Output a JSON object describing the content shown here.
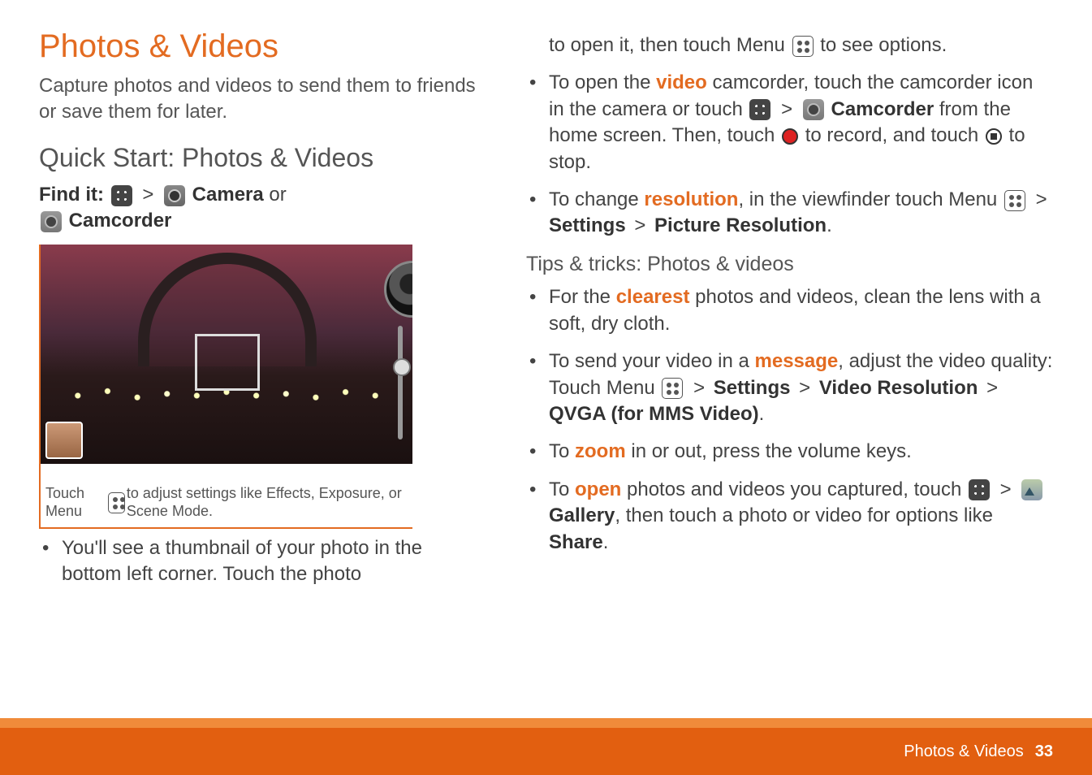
{
  "header": {
    "title": "Photos & Videos",
    "intro": "Capture photos and videos to send them to friends or save them for later."
  },
  "quickstart": {
    "heading": "Quick Start: Photos & Videos",
    "findit_label": "Find it:",
    "findit_or": "or",
    "camera_label": "Camera",
    "camcorder_label": "Camcorder"
  },
  "viewfinder": {
    "caption_prefix": "Touch Menu ",
    "caption_suffix": " to adjust settings like Effects, Exposure, or Scene Mode."
  },
  "left_bullets": {
    "thumbnail": "You'll see a thumbnail of your photo in the bottom left corner. Touch the photo"
  },
  "right": {
    "open_options_a": "to open it, then touch Menu ",
    "open_options_b": " to see options.",
    "video_a": "To open the ",
    "video_word": "video",
    "video_b": " camcorder, touch the camcorder icon in the camera or touch ",
    "video_camcorder": "Camcorder",
    "video_c": " from the home screen. Then, touch ",
    "video_d": " to record, and touch ",
    "video_e": " to stop.",
    "res_a": "To change ",
    "res_word": "resolution",
    "res_b": ", in the viewfinder touch Menu ",
    "res_settings": "Settings",
    "res_picture_res": "Picture Resolution",
    "period": "."
  },
  "tips": {
    "heading": "Tips & tricks: Photos & videos",
    "clear_a": "For the ",
    "clear_word": "clearest",
    "clear_b": " photos and videos, clean the lens with a soft, dry cloth.",
    "msg_a": "To send your video in a ",
    "msg_word": "message",
    "msg_b": ", adjust the video quality: Touch Menu ",
    "msg_settings": "Settings",
    "msg_videores": "Video Resolution",
    "msg_qvga": "QVGA (for MMS Video)",
    "zoom_a": "To ",
    "zoom_word": "zoom",
    "zoom_b": " in or out, press the volume keys.",
    "open_a": "To ",
    "open_word": "open",
    "open_b": " photos and videos you captured, touch ",
    "open_gallery": "Gallery",
    "open_c": ", then touch a photo or video for options like ",
    "open_share": "Share"
  },
  "footer": {
    "section": "Photos & Videos",
    "page": "33"
  },
  "gt": ">"
}
